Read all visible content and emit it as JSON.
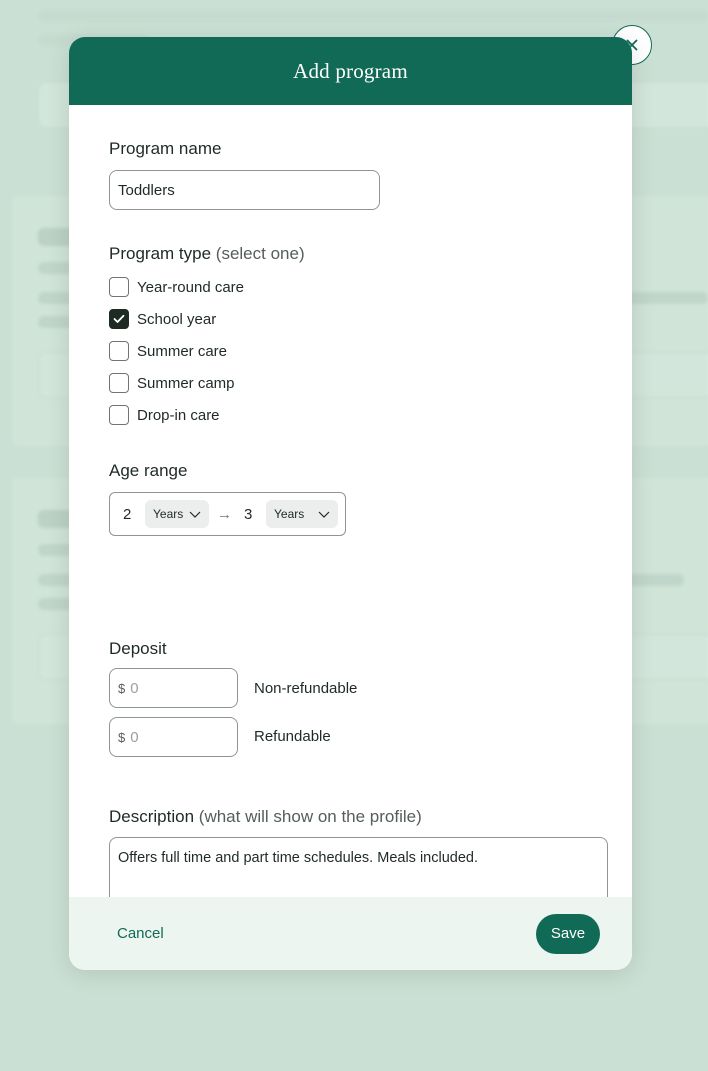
{
  "modal": {
    "title": "Add program",
    "close_icon": "close-icon"
  },
  "program_name": {
    "label": "Program name",
    "value": "Toddlers"
  },
  "program_type": {
    "label": "Program type",
    "hint": "(select one)",
    "options": [
      {
        "label": "Year-round care",
        "checked": false
      },
      {
        "label": "School year",
        "checked": true
      },
      {
        "label": "Summer care",
        "checked": false
      },
      {
        "label": "Summer camp",
        "checked": false
      },
      {
        "label": "Drop-in care",
        "checked": false
      }
    ]
  },
  "age_range": {
    "label": "Age range",
    "from_value": "2",
    "from_unit": "Years",
    "arrow": "→",
    "to_value": "3",
    "to_unit": "Years"
  },
  "deposit": {
    "label": "Deposit",
    "currency": "$",
    "rows": [
      {
        "placeholder": "0",
        "label": "Non-refundable"
      },
      {
        "placeholder": "0",
        "label": "Refundable"
      }
    ]
  },
  "description": {
    "label": "Description",
    "hint": "(what will show on the profile)",
    "value": "Offers full time and part time schedules. Meals included."
  },
  "footer": {
    "cancel_label": "Cancel",
    "save_label": "Save"
  },
  "colors": {
    "brand": "#116a55",
    "backdrop": "#cbe0d4",
    "footer_bg": "#edf5f0"
  }
}
